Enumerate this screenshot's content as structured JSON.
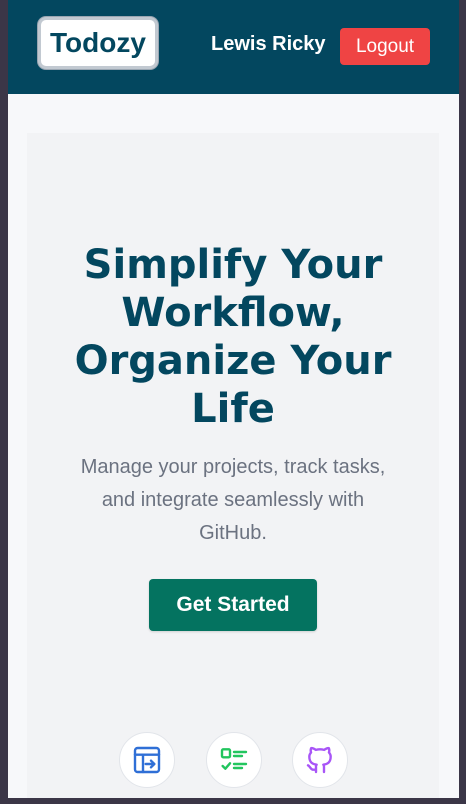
{
  "navbar": {
    "logo_text": "Todozy",
    "username": "Lewis Ricky",
    "logout_label": "Logout"
  },
  "hero": {
    "headline_lines": [
      "Simplify Your",
      "Workflow,",
      "Organize Your",
      "Life"
    ],
    "tagline_lines": [
      "Manage your projects, track tasks,",
      "and integrate seamlessly with",
      "GitHub."
    ],
    "cta_label": "Get Started"
  },
  "features": {
    "icons": [
      "project-board-icon",
      "task-checklist-icon",
      "github-icon"
    ]
  },
  "colors": {
    "navbar_bg": "#03475f",
    "logout_bg": "#ef4444",
    "cta_bg": "#047360",
    "headline": "#03475f",
    "icon_blue": "#2f6fd6",
    "icon_green": "#22c55e",
    "icon_purple": "#a855f7"
  }
}
